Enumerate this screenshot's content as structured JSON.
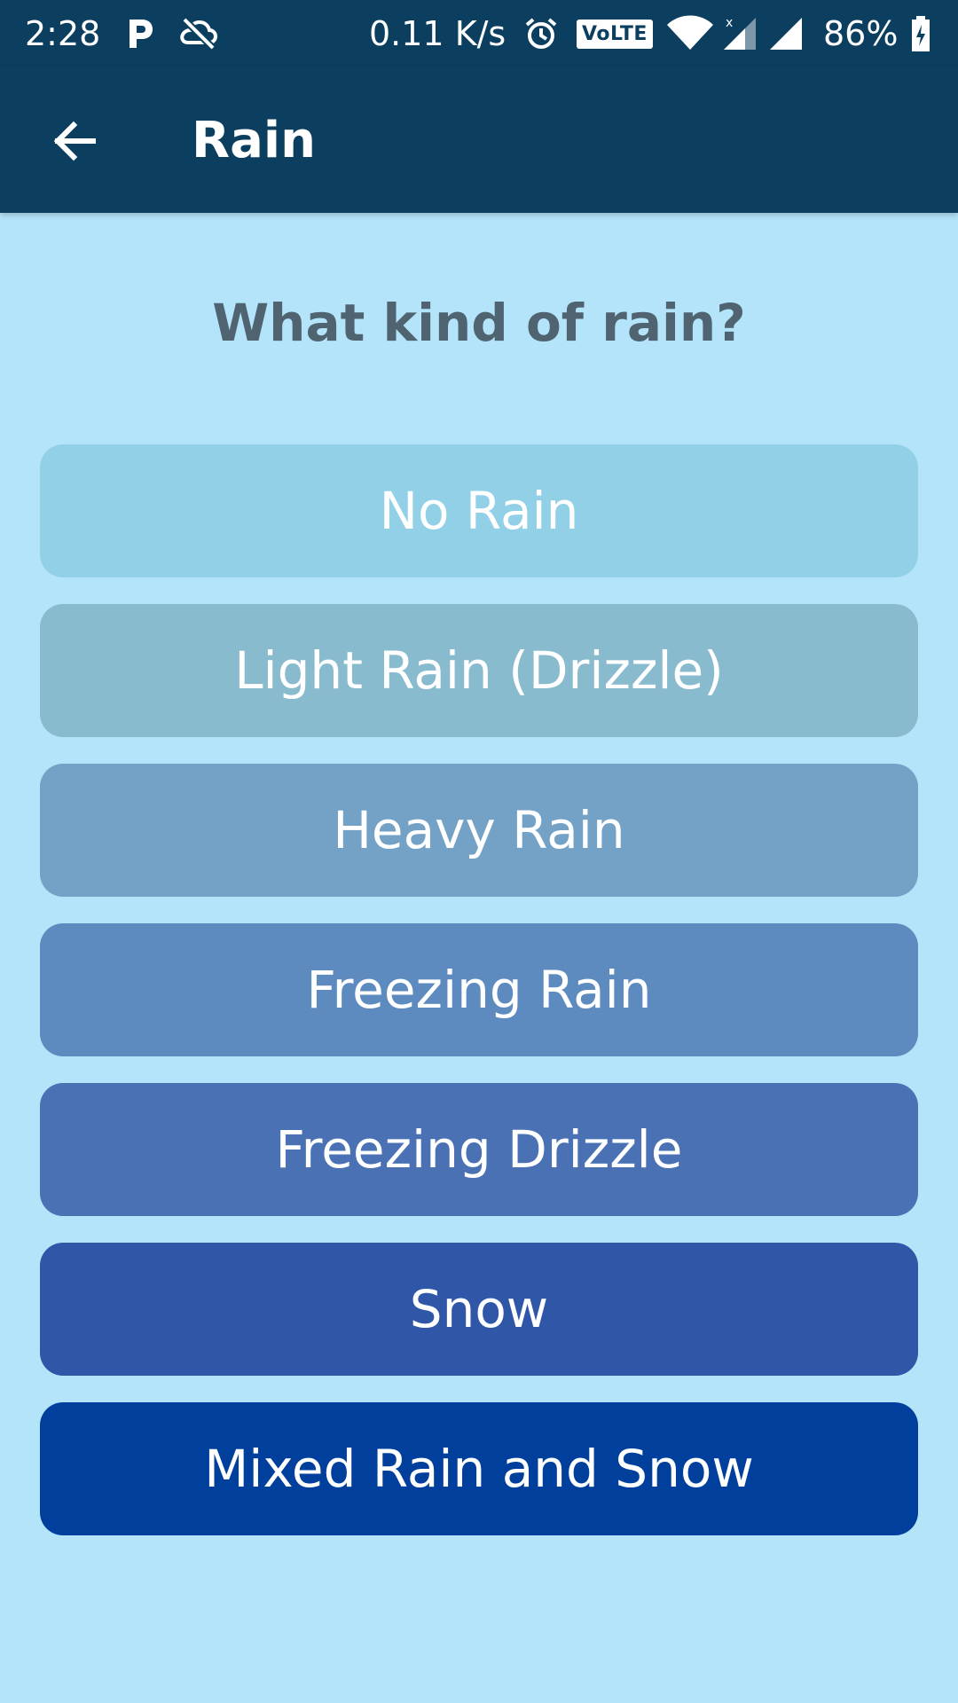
{
  "status_bar": {
    "time": "2:28",
    "network_speed": "0.11 K/s",
    "volte": "VoLTE",
    "battery_percent": "86%",
    "icons": [
      "parking-icon",
      "sync-off-icon",
      "alarm-icon",
      "volte-icon",
      "wifi-icon",
      "signal-icon",
      "signal-icon",
      "battery-charging-icon"
    ]
  },
  "app_bar": {
    "title": "Rain",
    "back_icon": "arrow-back-icon",
    "background": "#0b3e5f"
  },
  "question": "What kind of rain?",
  "options": [
    {
      "label": "No Rain",
      "color": "#92d0e7"
    },
    {
      "label": "Light Rain (Drizzle)",
      "color": "#89bbcf"
    },
    {
      "label": "Heavy Rain",
      "color": "#74a2c6"
    },
    {
      "label": "Freezing Rain",
      "color": "#5e8bbf"
    },
    {
      "label": "Freezing Drizzle",
      "color": "#4a71b3"
    },
    {
      "label": "Snow",
      "color": "#2f56a7"
    },
    {
      "label": "Mixed Rain and Snow",
      "color": "#003f9c"
    }
  ],
  "colors": {
    "page_background": "#b4e4f9",
    "question_text": "#4f6371"
  }
}
